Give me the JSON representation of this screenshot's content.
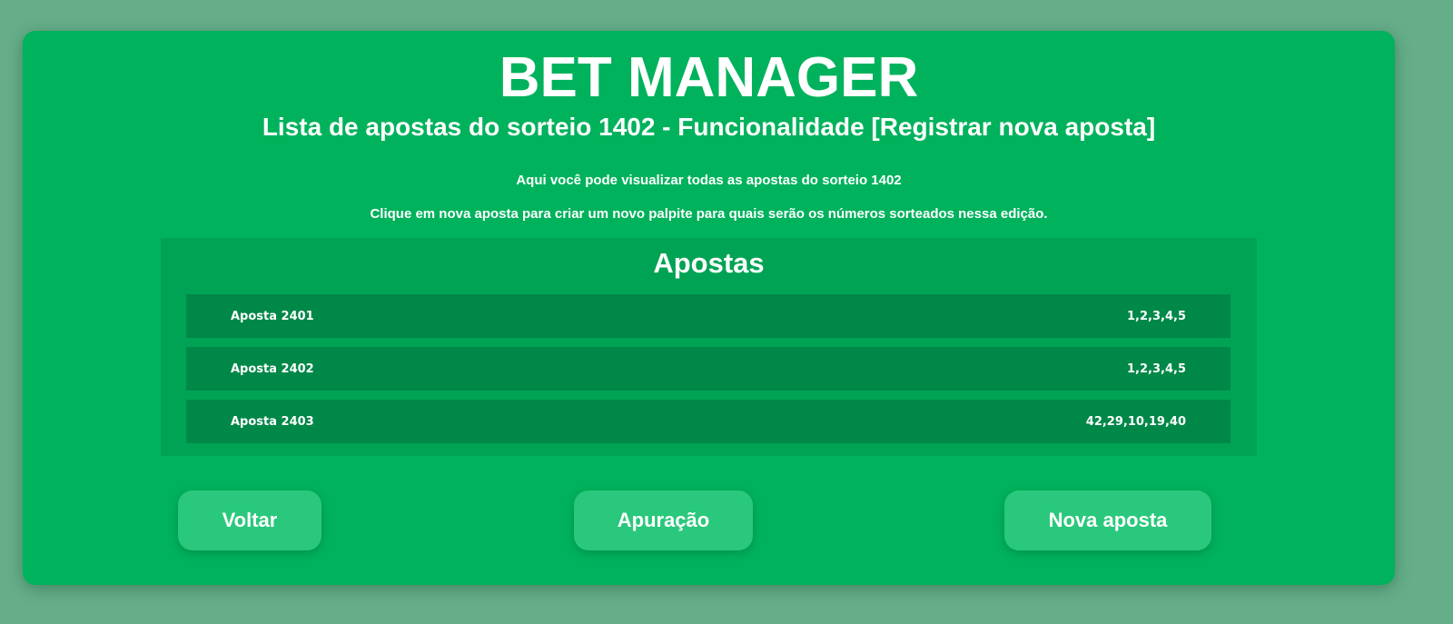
{
  "header": {
    "title": "BET MANAGER",
    "subtitle": "Lista de apostas do sorteio 1402 - Funcionalidade [Registrar nova aposta]"
  },
  "description": {
    "line1": "Aqui você pode visualizar todas as apostas do sorteio 1402",
    "line2": "Clique em nova aposta para criar um novo palpite para quais serão os números sorteados nessa edição."
  },
  "bets": {
    "title": "Apostas",
    "items": [
      {
        "name": "Aposta 2401",
        "numbers": "1,2,3,4,5"
      },
      {
        "name": "Aposta 2402",
        "numbers": "1,2,3,4,5"
      },
      {
        "name": "Aposta 2403",
        "numbers": "42,29,10,19,40"
      }
    ]
  },
  "actions": {
    "back_label": "Voltar",
    "results_label": "Apuração",
    "new_bet_label": "Nova aposta"
  },
  "colors": {
    "background": "#66ae8a",
    "card": "#00b25c",
    "panel": "#00a354",
    "row": "#008848",
    "button": "#2ac87c"
  }
}
